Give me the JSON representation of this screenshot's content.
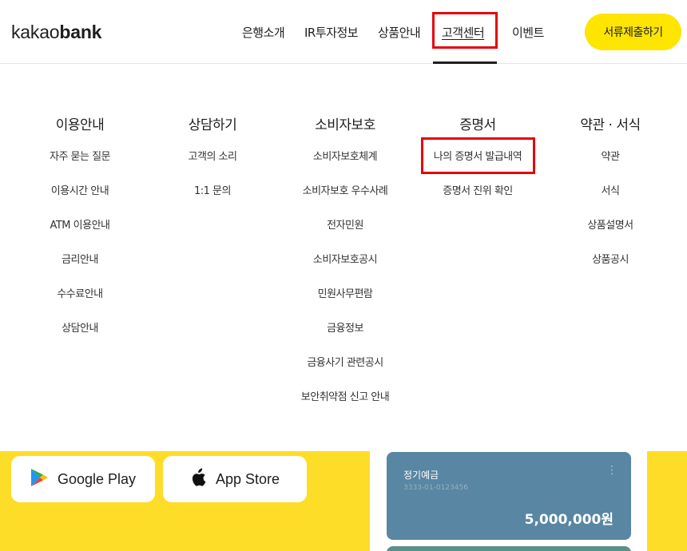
{
  "header": {
    "logo_light": "kakao",
    "logo_bold": "bank",
    "nav": [
      "은행소개",
      "IR투자정보",
      "상품안내",
      "고객센터",
      "이벤트"
    ],
    "active_nav": "고객센터",
    "apply_button": "서류제출하기"
  },
  "menu": {
    "columns": [
      {
        "title": "이용안내",
        "items": [
          "자주 묻는 질문",
          "이용시간 안내",
          "ATM 이용안내",
          "금리안내",
          "수수료안내",
          "상담안내"
        ]
      },
      {
        "title": "상담하기",
        "items": [
          "고객의 소리",
          "1:1 문의"
        ]
      },
      {
        "title": "소비자보호",
        "items": [
          "소비자보호체계",
          "소비자보호 우수사례",
          "전자민원",
          "소비자보호공시",
          "민원사무편람",
          "금융정보",
          "금융사기 관련공시",
          "보안취약점 신고 안내"
        ]
      },
      {
        "title": "증명서",
        "items": [
          "나의 증명서 발급내역",
          "증명서 진위 확인"
        ]
      },
      {
        "title": "약관 · 서식",
        "items": [
          "약관",
          "서식",
          "상품설명서",
          "상품공시"
        ]
      }
    ]
  },
  "footer": {
    "google_play": "Google Play",
    "app_store": "App Store",
    "card": {
      "title": "정기예금",
      "account": "3333-01-0123456",
      "amount": "5,000,000원"
    }
  },
  "colors": {
    "brand_yellow": "#fee500",
    "band_yellow": "#fddd27",
    "highlight_red": "#e4050e",
    "card_blue": "#5886a3"
  }
}
